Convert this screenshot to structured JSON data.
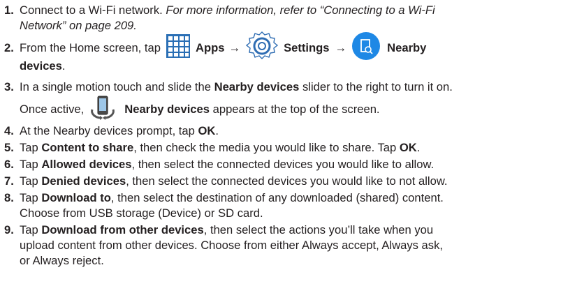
{
  "steps": [
    {
      "number": "1.",
      "text": "Connect to a Wi-Fi network. ",
      "italic_line1": "For more information, refer to “Connecting to a Wi-Fi",
      "italic_line2": "Network” on page 209."
    },
    {
      "number": "2.",
      "prefix": "From the Home screen, tap",
      "apps": "Apps",
      "arrow": "→",
      "settings": "Settings",
      "nearby_line1": "Nearby",
      "nearby_line2": "devices",
      "period": "."
    },
    {
      "number": "3.",
      "line1_a": "In a single motion touch and slide the ",
      "line1_b": "Nearby devices",
      "line1_c": " slider to the right to turn it on.",
      "line2_a": "Once active,",
      "line2_b": "Nearby devices",
      "line2_c": " appears at the top of the screen."
    },
    {
      "number": "4.",
      "a": "At the Nearby devices prompt, tap ",
      "b": "OK",
      "c": "."
    },
    {
      "number": "5.",
      "a": "Tap ",
      "b": "Content to share",
      "c": ", then check the media you would like to share. Tap ",
      "d": "OK",
      "e": "."
    },
    {
      "number": "6.",
      "a": "Tap ",
      "b": "Allowed devices",
      "c": ", then select the connected devices you would like to allow."
    },
    {
      "number": "7.",
      "a": "Tap ",
      "b": "Denied devices",
      "c": ", then select the connected devices you would like to not allow."
    },
    {
      "number": "8.",
      "a": "Tap ",
      "b": "Download to",
      "c": ", then select the destination of any downloaded (shared) content.",
      "line2": "Choose from USB storage (Device) or SD card."
    },
    {
      "number": "9.",
      "a": "Tap ",
      "b": "Download from other devices",
      "c": ", then select the actions you’ll take when you",
      "line2": "upload content from other devices. Choose from either Always accept, Always ask,",
      "line3": "or Always reject."
    }
  ],
  "icons": {
    "apps": "apps-grid-icon",
    "settings": "settings-gear-icon",
    "nearby": "nearby-devices-icon",
    "nearby_status": "nearby-devices-status-icon"
  },
  "colors": {
    "apps_icon": "#2a6fb5",
    "settings_icon": "#2f6db3",
    "nearby_icon": "#1e88e5",
    "text": "#231f20"
  }
}
